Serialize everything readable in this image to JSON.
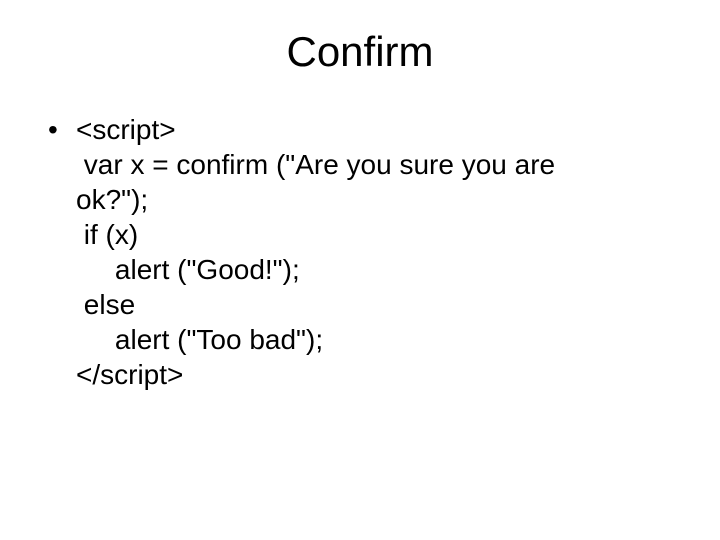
{
  "title": "Confirm",
  "bullet": {
    "lines": [
      "<script>",
      " var x = confirm (\"Are you sure you are",
      "ok?\");",
      " if (x)",
      "     alert (\"Good!\");",
      " else",
      "     alert (\"Too bad\");",
      "</script>"
    ]
  }
}
